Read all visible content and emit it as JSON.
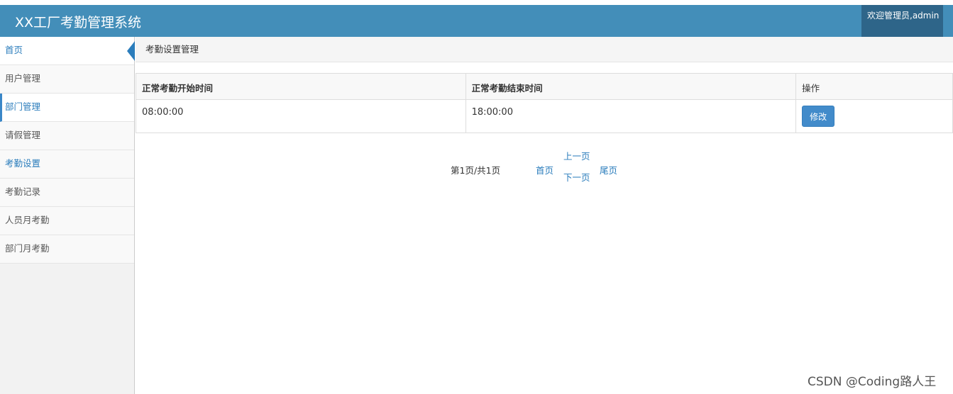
{
  "header": {
    "title": "XX工厂考勤管理系统",
    "welcome": "欢迎管理员,admin"
  },
  "sidebar": {
    "items": [
      {
        "label": "首页"
      },
      {
        "label": "用户管理"
      },
      {
        "label": "部门管理"
      },
      {
        "label": "请假管理"
      },
      {
        "label": "考勤设置"
      },
      {
        "label": "考勤记录"
      },
      {
        "label": "人员月考勤"
      },
      {
        "label": "部门月考勤"
      }
    ]
  },
  "breadcrumb": {
    "title": "考勤设置管理"
  },
  "table": {
    "columns": [
      "正常考勤开始时间",
      "正常考勤结束时间",
      "操作"
    ],
    "rows": [
      {
        "start": "08:00:00",
        "end": "18:00:00",
        "action": "修改"
      }
    ]
  },
  "pagination": {
    "info": "第1页/共1页",
    "first": "首页",
    "prev": "上一页",
    "next": "下一页",
    "last": "尾页"
  },
  "watermark": "CSDN @Coding路人王",
  "colors": {
    "header": "#438eb9",
    "welcome_box": "#2e6589",
    "accent": "#2b7dbc",
    "button": "#428bca"
  }
}
